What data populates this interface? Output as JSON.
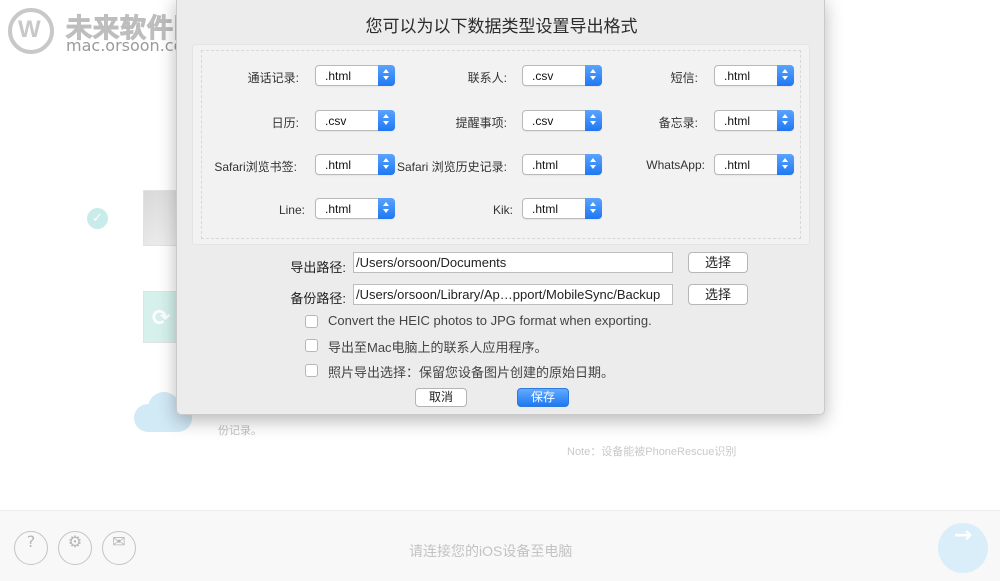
{
  "watermark": {
    "name": "未来软件园",
    "url": "mac.orsoon.com"
  },
  "background": {
    "text_backup": "份记录。",
    "note": "Note：设备能被PhoneRescue识别",
    "connect_prompt": "请连接您的iOS设备至电脑",
    "next_glyph": "→",
    "help_glyph": "?",
    "settings_glyph": "⚙",
    "mail_glyph": "✉",
    "check_glyph": "✓",
    "refresh_glyph": "⟳"
  },
  "dialog": {
    "title": "您可以为以下数据类型设置导出格式",
    "formats": [
      {
        "label": "通话记录:",
        "value": ".html"
      },
      {
        "label": "联系人:",
        "value": ".csv"
      },
      {
        "label": "短信:",
        "value": ".html"
      },
      {
        "label": "日历:",
        "value": ".csv"
      },
      {
        "label": "提醒事项:",
        "value": ".csv"
      },
      {
        "label": "备忘录:",
        "value": ".html"
      },
      {
        "label": "Safari浏览书签:",
        "value": ".html"
      },
      {
        "label": "Safari 浏览历史记录:",
        "value": ".html"
      },
      {
        "label": "WhatsApp:",
        "value": ".html"
      },
      {
        "label": "Line:",
        "value": ".html"
      },
      {
        "label": "Kik:",
        "value": ".html"
      }
    ],
    "export_path": {
      "label": "导出路径:",
      "value": "/Users/orsoon/Documents",
      "button": "选择"
    },
    "backup_path": {
      "label": "备份路径:",
      "value": "/Users/orsoon/Library/Ap…pport/MobileSync/Backup",
      "button": "选择"
    },
    "options": [
      {
        "text": "Convert the HEIC photos to JPG format when exporting.",
        "checked": false
      },
      {
        "text": "导出至Mac电脑上的联系人应用程序。",
        "checked": false
      },
      {
        "text": "照片导出选择：保留您设备图片创建的原始日期。",
        "checked": false
      }
    ],
    "cancel_label": "取消",
    "save_label": "保存"
  }
}
